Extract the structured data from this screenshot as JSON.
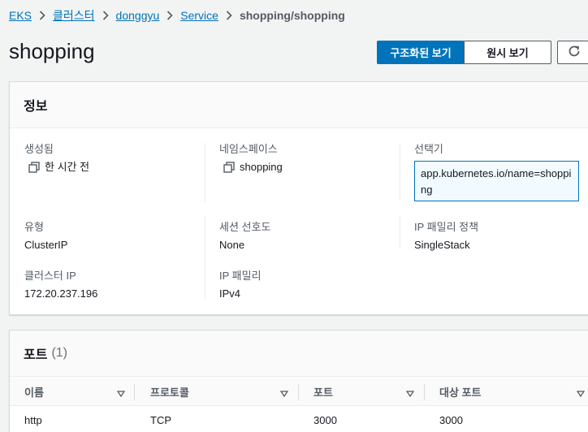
{
  "breadcrumb": {
    "items": [
      "EKS",
      "클러스터",
      "donggyu",
      "Service"
    ],
    "current": "shopping/shopping"
  },
  "page": {
    "title": "shopping"
  },
  "header_buttons": {
    "structured_view": "구조화된 보기",
    "raw_view": "원시 보기"
  },
  "info": {
    "title": "정보",
    "created_label": "생성됨",
    "created_value": "한 시간 전",
    "namespace_label": "네임스페이스",
    "namespace_value": "shopping",
    "selector_label": "선택기",
    "selector_value": "app.kubernetes.io/name=shopping",
    "type_label": "유형",
    "type_value": "ClusterIP",
    "session_affinity_label": "세션 선호도",
    "session_affinity_value": "None",
    "ip_family_policy_label": "IP 패밀리 정책",
    "ip_family_policy_value": "SingleStack",
    "cluster_ip_label": "클러스터 IP",
    "cluster_ip_value": "172.20.237.196",
    "ip_family_label": "IP 패밀리",
    "ip_family_value": "IPv4"
  },
  "ports": {
    "title": "포트",
    "count": "(1)",
    "columns": [
      "이름",
      "프로토콜",
      "포트",
      "대상 포트"
    ],
    "rows": [
      [
        "http",
        "TCP",
        "3000",
        "3000"
      ]
    ]
  },
  "colors": {
    "primary": "#0073bb",
    "link": "#0073bb",
    "background": "#f2f3f3"
  }
}
